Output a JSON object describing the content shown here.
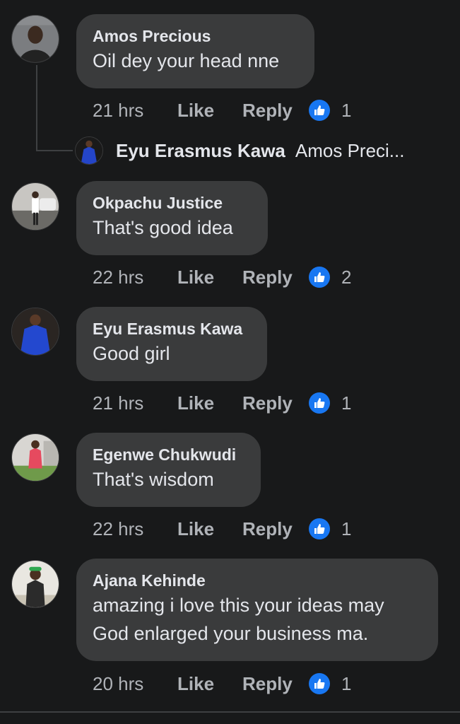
{
  "comments": [
    {
      "author": "Amos Precious",
      "text_lines": [
        "Oil dey your head nne"
      ],
      "time": "21 hrs",
      "like_label": "Like",
      "reply_label": "Reply",
      "reaction_count": "1",
      "reaction_icon": "thumbs-up-icon"
    },
    {
      "author": "Okpachu Justice",
      "text_lines": [
        "That's good idea"
      ],
      "time": "22 hrs",
      "like_label": "Like",
      "reply_label": "Reply",
      "reaction_count": "2",
      "reaction_icon": "thumbs-up-icon"
    },
    {
      "author": "Eyu Erasmus Kawa",
      "text_lines": [
        "Good girl"
      ],
      "time": "21 hrs",
      "like_label": "Like",
      "reply_label": "Reply",
      "reaction_count": "1",
      "reaction_icon": "thumbs-up-icon"
    },
    {
      "author": "Egenwe Chukwudi",
      "text_lines": [
        "That's wisdom"
      ],
      "time": "22 hrs",
      "like_label": "Like",
      "reply_label": "Reply",
      "reaction_count": "1",
      "reaction_icon": "thumbs-up-icon"
    },
    {
      "author": "Ajana Kehinde",
      "text_lines": [
        "amazing i love this your ideas may",
        "God enlarged your business ma."
      ],
      "time": "20 hrs",
      "like_label": "Like",
      "reply_label": "Reply",
      "reaction_count": "1",
      "reaction_icon": "thumbs-up-icon"
    }
  ],
  "reply_preview": {
    "author": "Eyu Erasmus Kawa",
    "text": "Amos Preci..."
  },
  "colors": {
    "background": "#18191a",
    "bubble": "#3a3b3c",
    "primary_text": "#e4e6eb",
    "secondary_text": "#b0b3b8",
    "reaction_blue": "#1877f2"
  }
}
